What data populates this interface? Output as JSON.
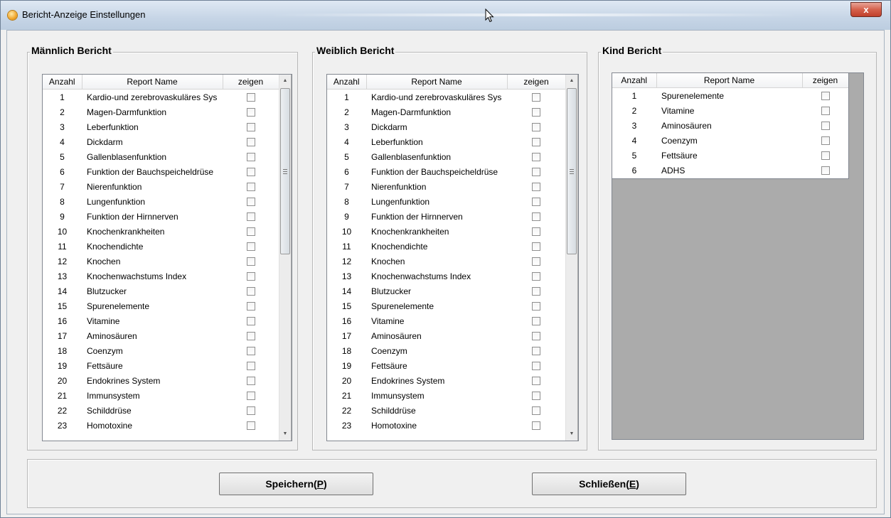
{
  "window": {
    "title": "Bericht-Anzeige Einstellungen",
    "close_label": "x"
  },
  "columns": {
    "count": "Anzahl",
    "name": "Report Name",
    "show": "zeigen"
  },
  "male": {
    "title": "Männlich Bericht",
    "rows": [
      {
        "num": "1",
        "name": "Kardio-und zerebrovaskuläres Sys"
      },
      {
        "num": "2",
        "name": "Magen-Darmfunktion"
      },
      {
        "num": "3",
        "name": "Leberfunktion"
      },
      {
        "num": "4",
        "name": "Dickdarm"
      },
      {
        "num": "5",
        "name": "Gallenblasenfunktion"
      },
      {
        "num": "6",
        "name": "Funktion der Bauchspeicheldrüse"
      },
      {
        "num": "7",
        "name": "Nierenfunktion"
      },
      {
        "num": "8",
        "name": "Lungenfunktion"
      },
      {
        "num": "9",
        "name": "Funktion der Hirnnerven"
      },
      {
        "num": "10",
        "name": "Knochenkrankheiten"
      },
      {
        "num": "11",
        "name": "Knochendichte"
      },
      {
        "num": "12",
        "name": "Knochen"
      },
      {
        "num": "13",
        "name": "Knochenwachstums Index"
      },
      {
        "num": "14",
        "name": "Blutzucker"
      },
      {
        "num": "15",
        "name": "Spurenelemente"
      },
      {
        "num": "16",
        "name": "Vitamine"
      },
      {
        "num": "17",
        "name": "Aminosäuren"
      },
      {
        "num": "18",
        "name": "Coenzym"
      },
      {
        "num": "19",
        "name": "Fettsäure"
      },
      {
        "num": "20",
        "name": "Endokrines System"
      },
      {
        "num": "21",
        "name": "Immunsystem"
      },
      {
        "num": "22",
        "name": "Schilddrüse"
      },
      {
        "num": "23",
        "name": "Homotoxine"
      }
    ]
  },
  "female": {
    "title": "Weiblich Bericht",
    "rows": [
      {
        "num": "1",
        "name": "Kardio-und zerebrovaskuläres Sys"
      },
      {
        "num": "2",
        "name": "Magen-Darmfunktion"
      },
      {
        "num": "3",
        "name": "Dickdarm"
      },
      {
        "num": "4",
        "name": "Leberfunktion"
      },
      {
        "num": "5",
        "name": "Gallenblasenfunktion"
      },
      {
        "num": "6",
        "name": "Funktion der Bauchspeicheldrüse"
      },
      {
        "num": "7",
        "name": "Nierenfunktion"
      },
      {
        "num": "8",
        "name": "Lungenfunktion"
      },
      {
        "num": "9",
        "name": "Funktion der Hirnnerven"
      },
      {
        "num": "10",
        "name": "Knochenkrankheiten"
      },
      {
        "num": "11",
        "name": "Knochendichte"
      },
      {
        "num": "12",
        "name": "Knochen"
      },
      {
        "num": "13",
        "name": "Knochenwachstums Index"
      },
      {
        "num": "14",
        "name": "Blutzucker"
      },
      {
        "num": "15",
        "name": "Spurenelemente"
      },
      {
        "num": "16",
        "name": "Vitamine"
      },
      {
        "num": "17",
        "name": "Aminosäuren"
      },
      {
        "num": "18",
        "name": "Coenzym"
      },
      {
        "num": "19",
        "name": "Fettsäure"
      },
      {
        "num": "20",
        "name": "Endokrines System"
      },
      {
        "num": "21",
        "name": "Immunsystem"
      },
      {
        "num": "22",
        "name": "Schilddrüse"
      },
      {
        "num": "23",
        "name": "Homotoxine"
      }
    ]
  },
  "child": {
    "title": "Kind Bericht",
    "rows": [
      {
        "num": "1",
        "name": "Spurenelemente"
      },
      {
        "num": "2",
        "name": "Vitamine"
      },
      {
        "num": "3",
        "name": "Aminosäuren"
      },
      {
        "num": "4",
        "name": "Coenzym"
      },
      {
        "num": "5",
        "name": "Fettsäure"
      },
      {
        "num": "6",
        "name": "ADHS"
      }
    ]
  },
  "buttons": {
    "save_text": "Speichern(",
    "save_key": "P",
    "save_close": ")",
    "close_text": "Schließen(",
    "close_key": "E",
    "close_close": ")"
  }
}
